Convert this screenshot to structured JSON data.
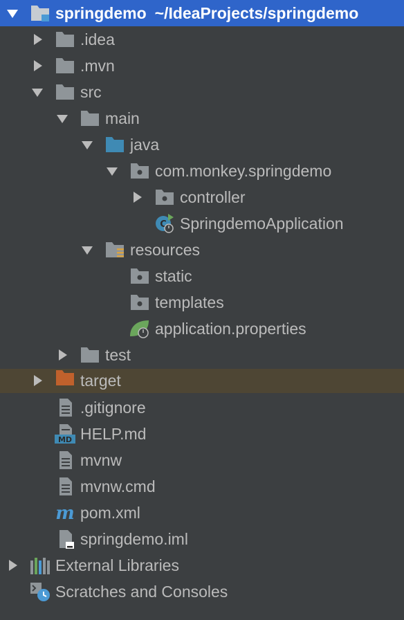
{
  "project_tree": {
    "root": {
      "name": "springdemo",
      "path": "~/IdeaProjects/springdemo"
    },
    "idea": ".idea",
    "mvn": ".mvn",
    "src": "src",
    "main": "main",
    "java": "java",
    "package": "com.monkey.springdemo",
    "controller": "controller",
    "app_class": "SpringdemoApplication",
    "resources": "resources",
    "static": "static",
    "templates": "templates",
    "app_props": "application.properties",
    "test": "test",
    "target": "target",
    "gitignore": ".gitignore",
    "help": "HELP.md",
    "mvnw": "mvnw",
    "mvnw_cmd": "mvnw.cmd",
    "pom": "pom.xml",
    "iml": "springdemo.iml",
    "external_libraries": "External Libraries",
    "scratches": "Scratches and Consoles"
  },
  "icons": {
    "folder": "folder-icon",
    "module": "module-folder-icon",
    "source_root": "source-root-icon",
    "package": "package-icon",
    "resources": "resources-folder-icon",
    "excluded": "excluded-folder-icon",
    "spring_boot": "spring-boot-class-icon",
    "spring_props": "spring-properties-icon",
    "text_file": "text-file-icon",
    "markdown": "markdown-file-icon",
    "maven": "maven-icon",
    "iml": "iml-file-icon",
    "libraries": "libraries-icon",
    "scratches": "scratches-icon"
  },
  "colors": {
    "background": "#3c3f41",
    "selection": "#2f65ca",
    "hover_row": "#4e4634",
    "text": "#bbbbbb",
    "folder": "#8f9599",
    "source_blue": "#3f8ab4",
    "excluded_orange": "#c0612c",
    "spring_green": "#6ba65c"
  }
}
